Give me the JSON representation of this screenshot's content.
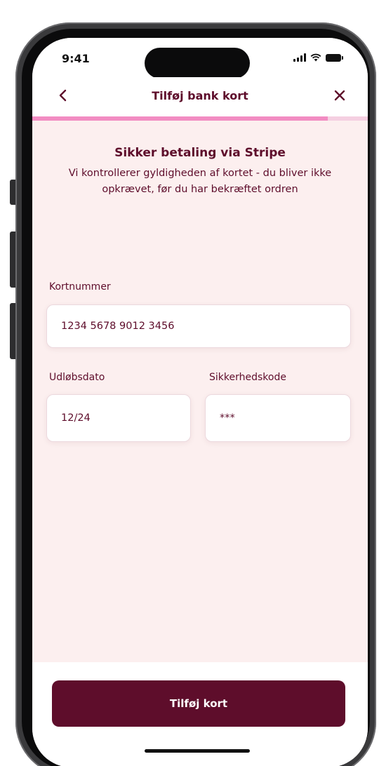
{
  "status_bar": {
    "time": "9:41",
    "icons": [
      "signal-icon",
      "wifi-icon",
      "battery-icon"
    ]
  },
  "header": {
    "back_icon": "chevron-left-icon",
    "title": "Tilføj bank kort",
    "close_icon": "close-icon"
  },
  "progress": {
    "fraction": 0.88,
    "track_color": "#f5cfe1",
    "fill_color": "#f28cc2"
  },
  "main": {
    "heading": "Sikker betaling via Stripe",
    "subtext": "Vi kontrollerer gyldigheden af kortet - du bliver ikke opkrævet, før du har bekræftet ordren",
    "card_number": {
      "label": "Kortnummer",
      "value": "1234 5678 9012 3456"
    },
    "expiry": {
      "label": "Udløbsdato",
      "value": "12/24"
    },
    "cvc": {
      "label": "Sikkerhedskode",
      "value": "***"
    }
  },
  "footer": {
    "button_label": "Tilføj kort"
  },
  "colors": {
    "brand": "#5e0d2b",
    "background": "#fcefef",
    "accent": "#f28cc2"
  }
}
